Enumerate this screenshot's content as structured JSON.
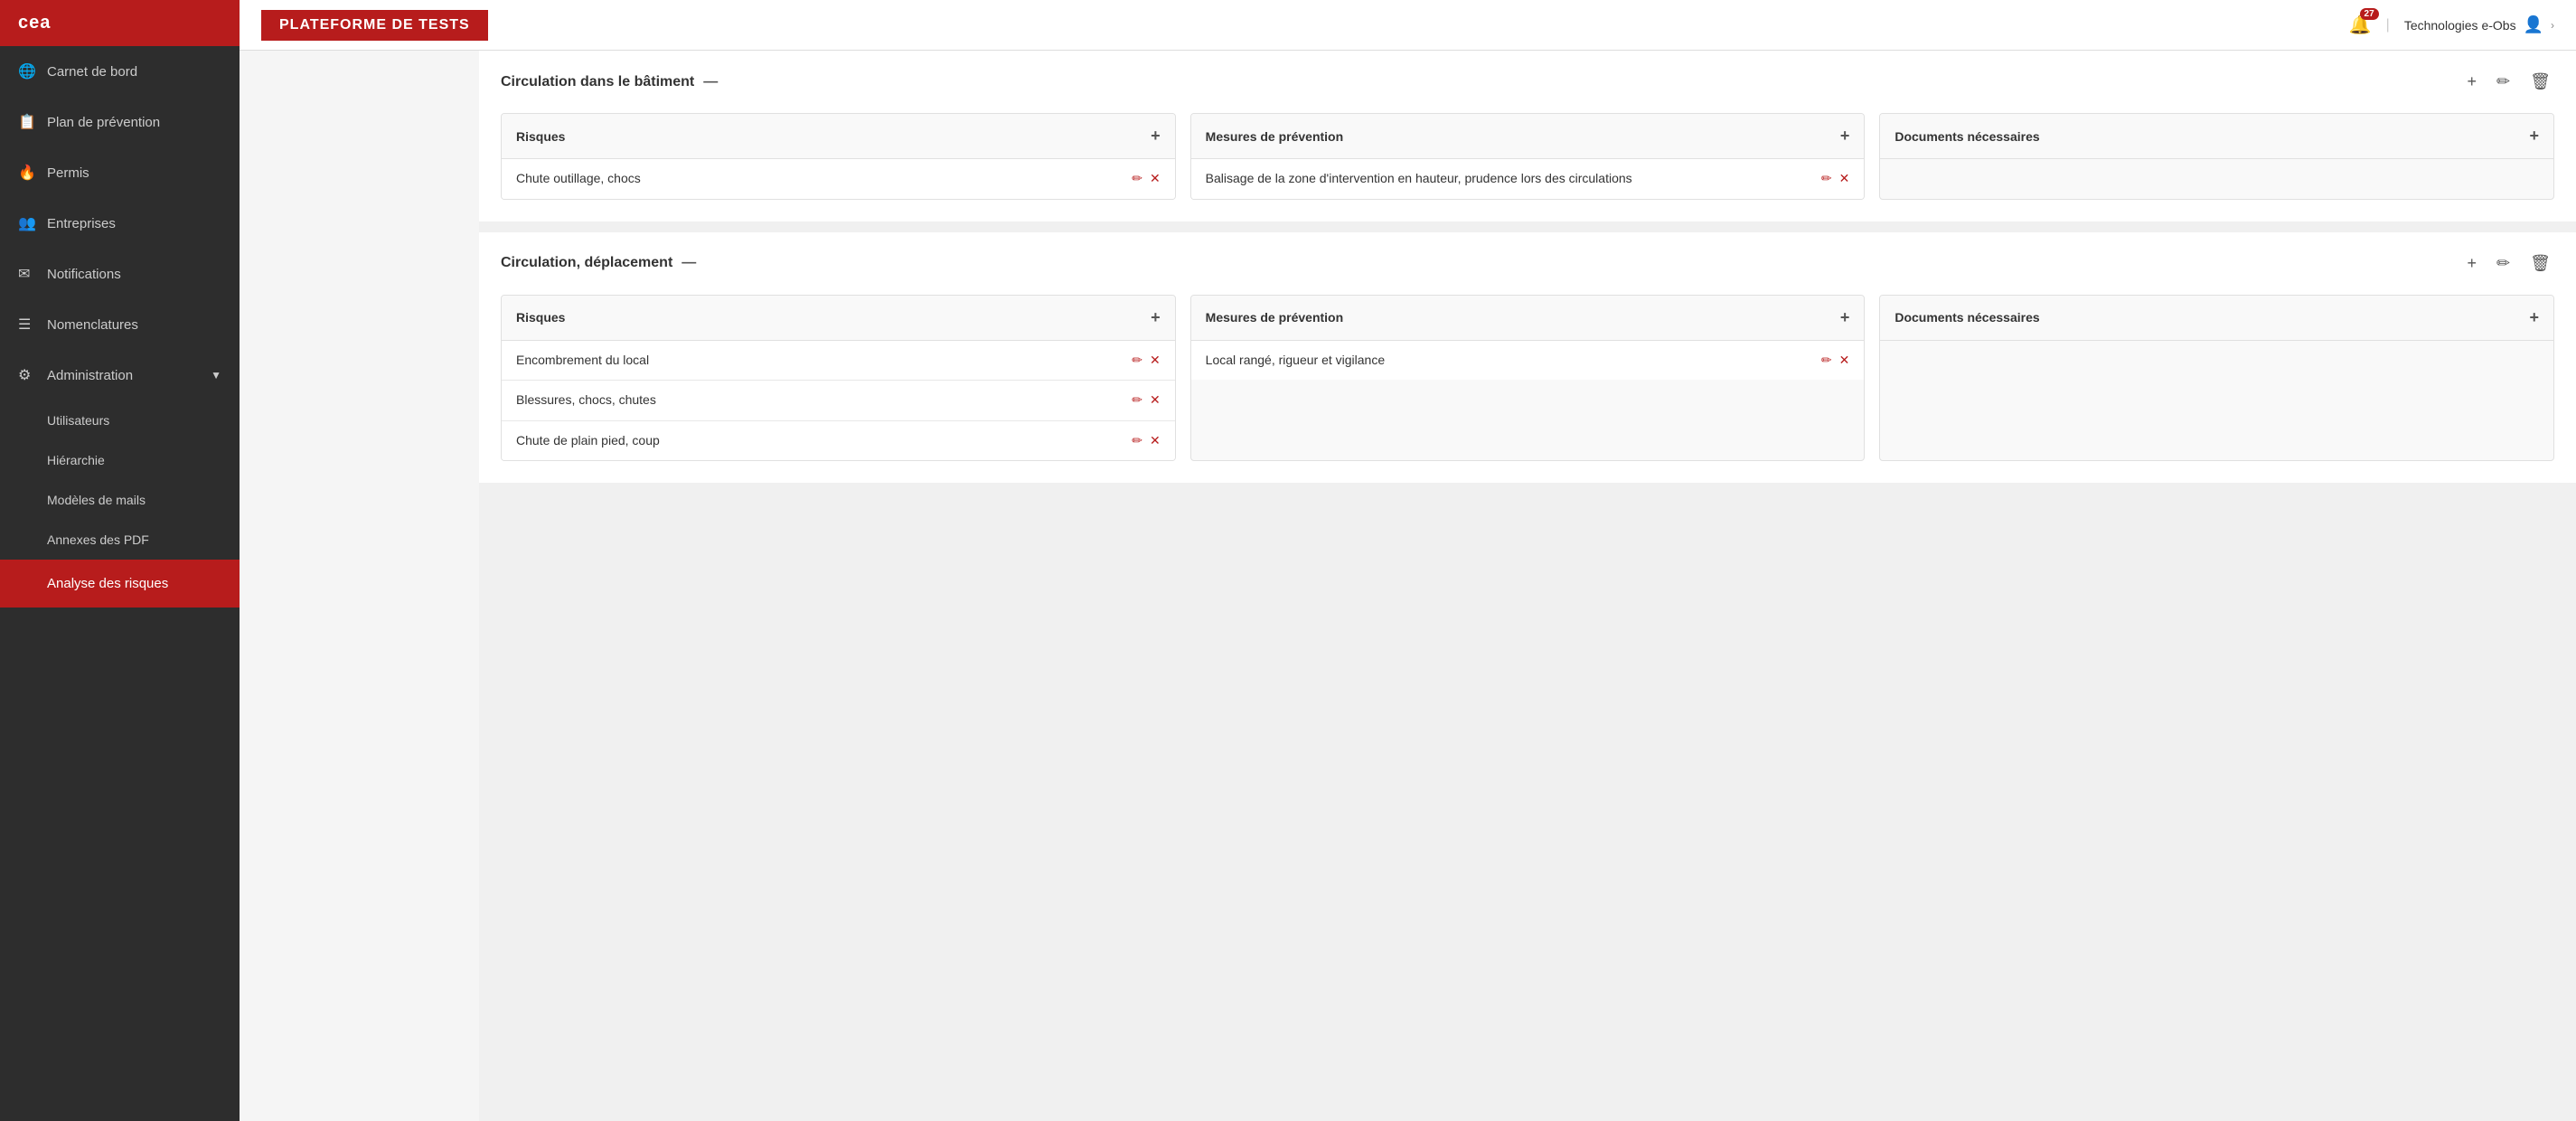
{
  "app": {
    "logo": "cea",
    "platform_title": "PLATEFORME DE TESTS"
  },
  "header": {
    "notification_count": "27",
    "user_name": "Technologies e-Obs",
    "notification_icon": "🔔",
    "user_icon": "👤",
    "arrow_icon": "›"
  },
  "sidebar": {
    "items": [
      {
        "id": "carnet",
        "label": "Carnet de bord",
        "icon": "🌐"
      },
      {
        "id": "plan",
        "label": "Plan de prévention",
        "icon": "📋"
      },
      {
        "id": "permis",
        "label": "Permis",
        "icon": "🔥"
      },
      {
        "id": "entreprises",
        "label": "Entreprises",
        "icon": "👥"
      },
      {
        "id": "notifications",
        "label": "Notifications",
        "icon": "✉"
      },
      {
        "id": "nomenclatures",
        "label": "Nomenclatures",
        "icon": "☰"
      },
      {
        "id": "administration",
        "label": "Administration",
        "icon": "⚙",
        "has_chevron": true
      },
      {
        "id": "analyse",
        "label": "Analyse des risques",
        "icon": "",
        "active": true
      }
    ],
    "sub_items": [
      {
        "id": "utilisateurs",
        "label": "Utilisateurs"
      },
      {
        "id": "hierarchie",
        "label": "Hiérarchie"
      },
      {
        "id": "modeles",
        "label": "Modèles de mails"
      },
      {
        "id": "annexes",
        "label": "Annexes des PDF"
      }
    ]
  },
  "sections": [
    {
      "id": "section-circulation-batiment",
      "title": "Circulation dans le bâtiment",
      "dash": "—",
      "actions": {
        "add": "+",
        "edit": "✏",
        "delete": "🗑"
      },
      "columns": [
        {
          "id": "risques-1",
          "title": "Risques",
          "add_btn": "+",
          "items": [
            {
              "id": "item-1",
              "text": "Chute outillage, chocs"
            }
          ]
        },
        {
          "id": "mesures-1",
          "title": "Mesures de prévention",
          "add_btn": "+",
          "items": [
            {
              "id": "item-2",
              "text": "Balisage de la zone d'intervention en hauteur, prudence lors des circulations"
            }
          ]
        },
        {
          "id": "documents-1",
          "title": "Documents nécessaires",
          "add_btn": "+",
          "items": []
        }
      ]
    },
    {
      "id": "section-circulation-deplacement",
      "title": "Circulation, déplacement",
      "dash": "—",
      "actions": {
        "add": "+",
        "edit": "✏",
        "delete": "🗑"
      },
      "columns": [
        {
          "id": "risques-2",
          "title": "Risques",
          "add_btn": "+",
          "items": [
            {
              "id": "item-3",
              "text": "Encombrement du local"
            },
            {
              "id": "item-4",
              "text": "Blessures, chocs, chutes"
            },
            {
              "id": "item-5",
              "text": "Chute de plain pied, coup"
            }
          ]
        },
        {
          "id": "mesures-2",
          "title": "Mesures de prévention",
          "add_btn": "+",
          "items": [
            {
              "id": "item-6",
              "text": "Local rangé, rigueur et vigilance"
            }
          ]
        },
        {
          "id": "documents-2",
          "title": "Documents nécessaires",
          "add_btn": "+",
          "items": []
        }
      ]
    }
  ],
  "icons": {
    "edit": "✏",
    "delete": "✕",
    "add": "+"
  }
}
